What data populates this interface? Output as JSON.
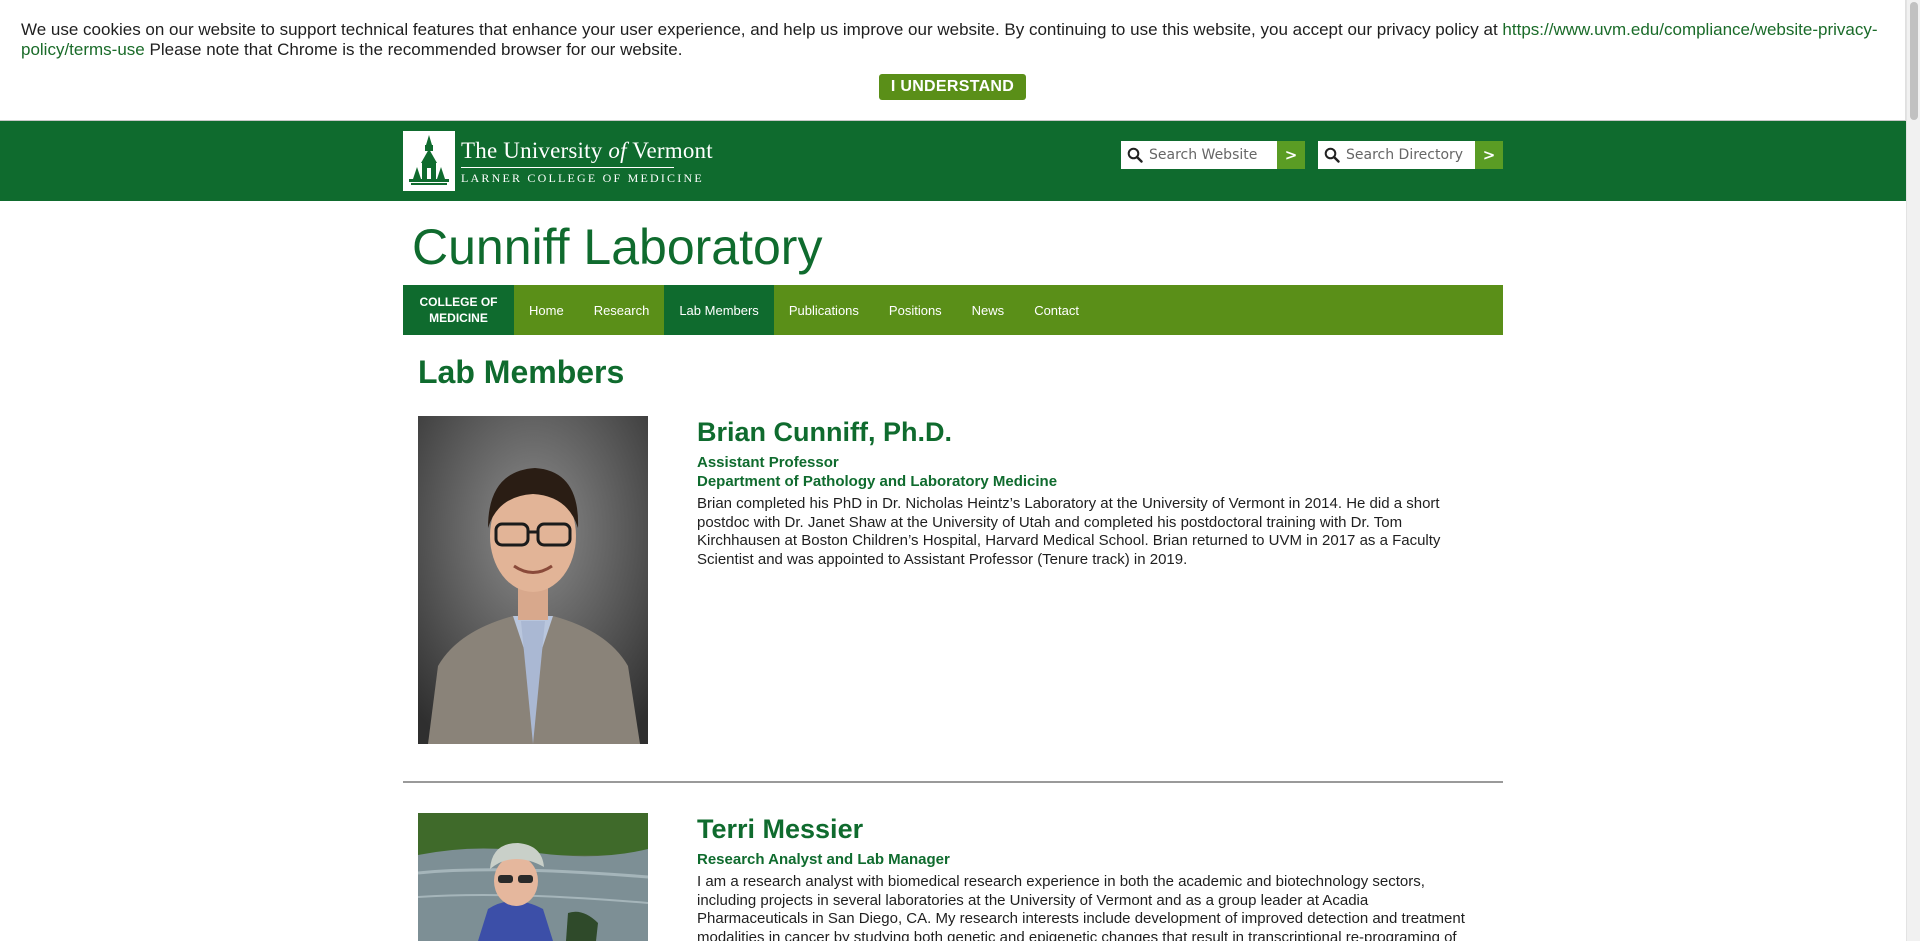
{
  "cookie_banner": {
    "text": "We use cookies on our website to support technical features that enhance your user experience, and help us improve our website. By continuing to use this website, you accept our privacy policy at",
    "link_text": "https://www.uvm.edu/compliance/website-privacy-policy/terms-use",
    "note": "Please note that Chrome is the recommended browser for our website.",
    "button_label": "I UNDERSTAND"
  },
  "header": {
    "logo_line1_pre": "The University",
    "logo_line1_of": "of",
    "logo_line1_post": "Vermont",
    "logo_line2": "LARNER COLLEGE OF MEDICINE",
    "search_website_placeholder": "Search Website",
    "search_directory_placeholder": "Search Directory",
    "search_go_label": ">"
  },
  "site_title": "Cunniff Laboratory",
  "nav": {
    "college_label": "COLLEGE OF MEDICINE",
    "items": [
      {
        "label": "Home"
      },
      {
        "label": "Research"
      },
      {
        "label": "Lab Members",
        "active": true
      },
      {
        "label": "Publications"
      },
      {
        "label": "Positions"
      },
      {
        "label": "News"
      },
      {
        "label": "Contact"
      }
    ]
  },
  "page_heading": "Lab Members",
  "members": [
    {
      "name": "Brian Cunniff, Ph.D.",
      "title": "Assistant Professor",
      "department": "Department of Pathology and Laboratory Medicine",
      "bio": "Brian completed his PhD in Dr. Nicholas Heintz’s Laboratory at the University of Vermont in 2014. He did a short postdoc with Dr. Janet Shaw at the University of Utah and completed his postdoctoral training with Dr. Tom Kirchhausen at Boston Children’s Hospital, Harvard Medical School. Brian returned to UVM in 2017 as a Faculty Scientist and was appointed to Assistant Professor (Tenure track) in 2019."
    },
    {
      "name": "Terri Messier",
      "title": "Research Analyst and Lab Manager",
      "bio": "I am a research analyst with biomedical research experience in both the academic and biotechnology sectors, including projects in several laboratories at the University of Vermont and as a group leader at Acadia Pharmaceuticals in San Diego, CA. My research interests include development of improved detection and treatment modalities in cancer by studying both genetic and epigenetic changes that result in transcriptional re-programing of"
    }
  ],
  "colors": {
    "brand_green": "#0f6b2e",
    "nav_green": "#5a8f18",
    "button_green": "#5a8f18"
  }
}
